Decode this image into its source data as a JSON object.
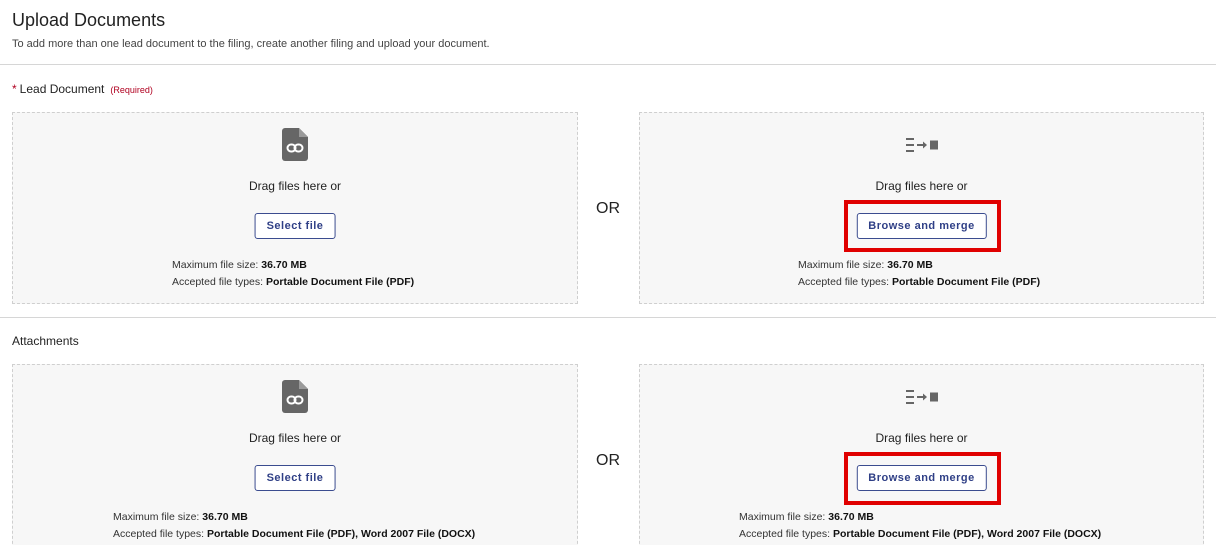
{
  "header": {
    "title": "Upload Documents",
    "subtitle": "To add more than one lead document to the filing, create another filing and upload your document."
  },
  "lead_section": {
    "star": "*",
    "title": "Lead Document",
    "required_note": "(Required)",
    "or_label": "OR",
    "file_zone": {
      "icon": "file-link-icon",
      "drag_text": "Drag files here or",
      "button_label": "Select file",
      "max_size_label": "Maximum file size:",
      "max_size_value": "36.70 MB",
      "types_label": "Accepted file types:",
      "types_value": "Portable Document File (PDF)"
    },
    "merge_zone": {
      "icon": "merge-list-icon",
      "drag_text": "Drag files here or",
      "button_label": "Browse and merge",
      "max_size_label": "Maximum file size:",
      "max_size_value": "36.70 MB",
      "types_label": "Accepted file types:",
      "types_value": "Portable Document File (PDF)"
    }
  },
  "attachments_section": {
    "title": "Attachments",
    "or_label": "OR",
    "file_zone": {
      "icon": "file-link-icon",
      "drag_text": "Drag files here or",
      "button_label": "Select file",
      "max_size_label": "Maximum file size:",
      "max_size_value": "36.70 MB",
      "types_label": "Accepted file types:",
      "types_value": "Portable Document File (PDF), Word 2007 File (DOCX)"
    },
    "merge_zone": {
      "icon": "merge-list-icon",
      "drag_text": "Drag files here or",
      "button_label": "Browse and merge",
      "max_size_label": "Maximum file size:",
      "max_size_value": "36.70 MB",
      "types_label": "Accepted file types:",
      "types_value": "Portable Document File (PDF), Word 2007 File (DOCX)"
    }
  },
  "colors": {
    "highlight": "#e00000",
    "button_text": "#2f3f86",
    "required": "#b00020",
    "icon": "#666666"
  }
}
